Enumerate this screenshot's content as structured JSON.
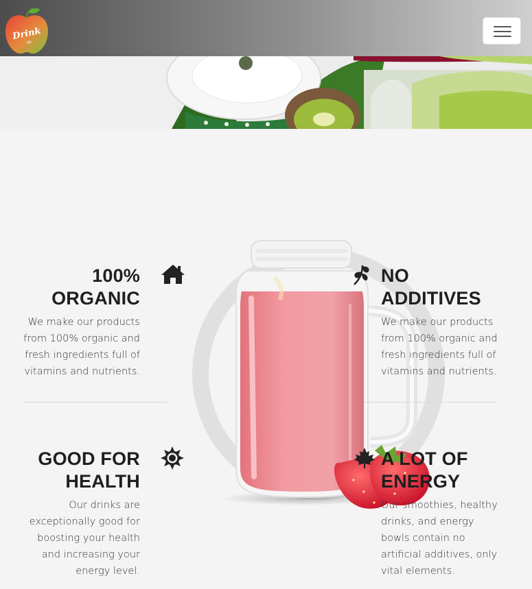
{
  "navbar": {
    "logo_text_main": "Drink",
    "logo_text_sub": "up",
    "menu_icon": "hamburger-icon"
  },
  "features": [
    {
      "title_line1": "100%",
      "title_line2": "ORGANIC",
      "icon": "home-icon",
      "text": [
        "We make our products",
        "from 100% organic and",
        "fresh ingredients full of",
        "vitamins and nutrients."
      ]
    },
    {
      "title_line1": "NO",
      "title_line2": "ADDITIVES",
      "icon": "leaf-icon",
      "text": [
        "We make our products",
        "from 100% organic and",
        "fresh ingredients full of",
        "vitamins and nutrients."
      ]
    },
    {
      "title_line1": "GOOD FOR",
      "title_line2": "HEALTH",
      "icon": "sun-icon",
      "text": [
        "Our drinks are",
        "exceptionally good for",
        "boosting your health",
        "and increasing your",
        "energy level."
      ]
    },
    {
      "title_line1": "A LOT OF",
      "title_line2": "ENERGY",
      "icon": "maple-leaf-icon",
      "text": [
        "Our smoothies, healthy",
        "drinks, and energy",
        "bowls contain no",
        "artificial additives, only",
        "vital elements."
      ]
    }
  ]
}
